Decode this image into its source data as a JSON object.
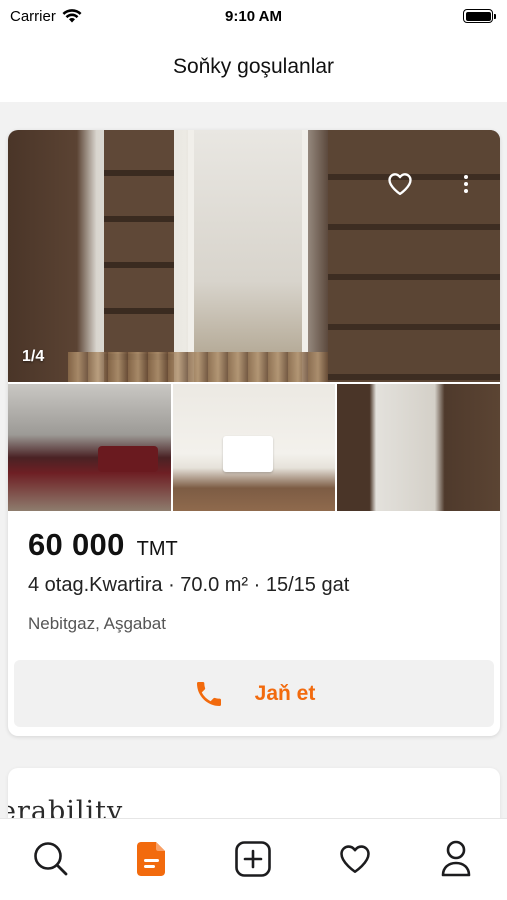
{
  "status_bar": {
    "carrier": "Carrier",
    "time": "9:10 AM"
  },
  "header": {
    "title": "Soňky goşulanlar"
  },
  "listing": {
    "photo_counter": "1/4",
    "price_value": "60 000",
    "price_currency": "TMT",
    "details": "4 otag.Kwartira · 70.0 m² · 15/15 gat",
    "location": "Nebitgaz, Aşgabat",
    "call_label": "Jaň et"
  },
  "next_card": {
    "partial_text": "erability"
  },
  "tab_bar": {
    "items": [
      {
        "icon": "search-icon",
        "active": false
      },
      {
        "icon": "document-icon",
        "active": true
      },
      {
        "icon": "add-square-icon",
        "active": false
      },
      {
        "icon": "heart-icon",
        "active": false
      },
      {
        "icon": "profile-icon",
        "active": false
      }
    ]
  },
  "colors": {
    "accent": "#f26a0d",
    "background": "#f2f2f2",
    "card": "#ffffff",
    "call_button_bg": "#f1f1f1"
  }
}
